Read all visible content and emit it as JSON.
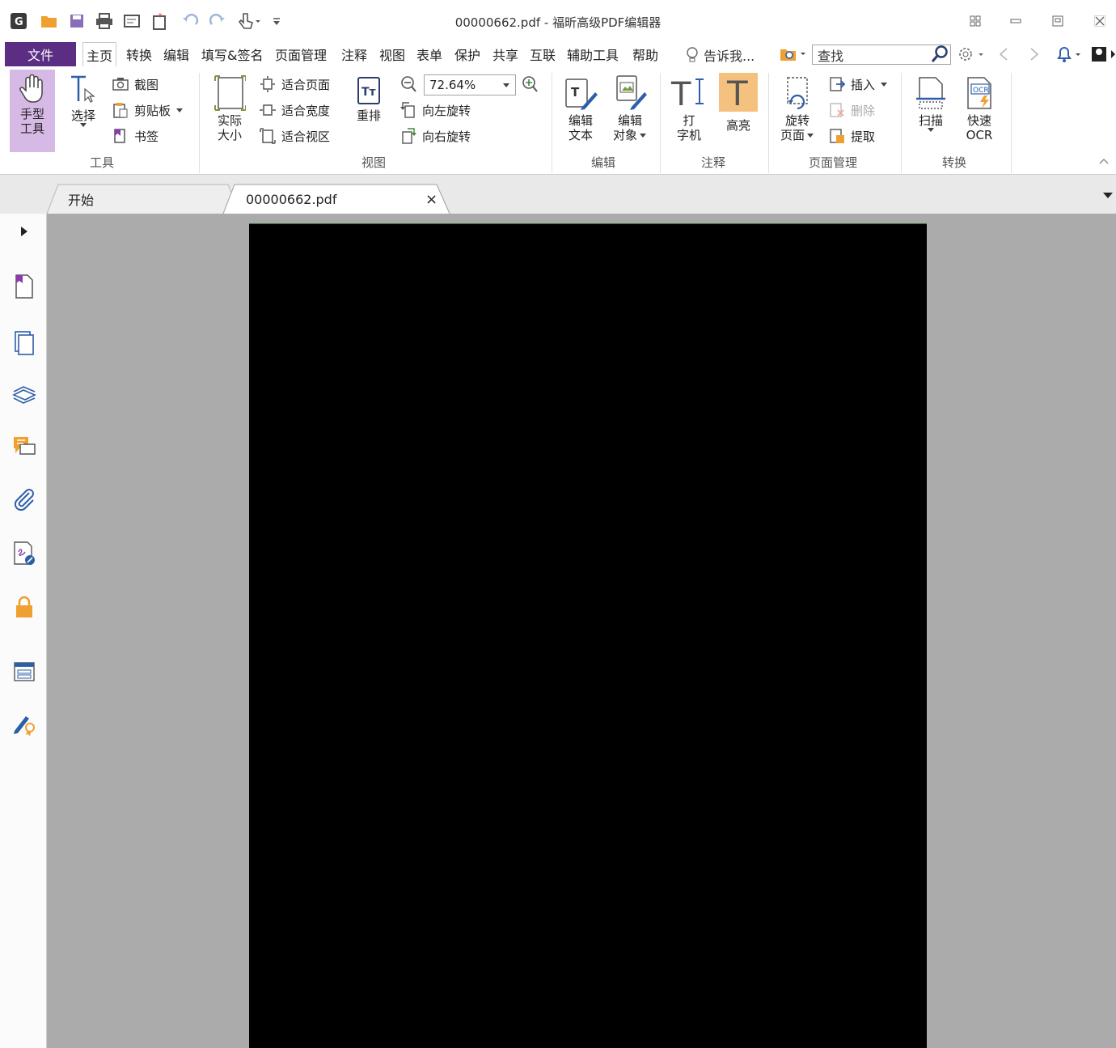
{
  "titlebar": {
    "title": "00000662.pdf - 福昕高级PDF编辑器"
  },
  "menubar": {
    "file": "文件",
    "tabs": [
      "主页",
      "转换",
      "编辑",
      "填写&签名",
      "页面管理",
      "注释",
      "视图",
      "表单",
      "保护",
      "共享",
      "互联",
      "辅助工具",
      "帮助"
    ],
    "tell_me": "告诉我...",
    "search_placeholder": "查找"
  },
  "ribbon": {
    "tools": {
      "group": "工具",
      "hand_l1": "手型",
      "hand_l2": "工具",
      "select": "选择",
      "screenshot": "截图",
      "clipboard": "剪贴板",
      "bookmark": "书签"
    },
    "view": {
      "group": "视图",
      "actual_l1": "实际",
      "actual_l2": "大小",
      "fit_page": "适合页面",
      "fit_width": "适合宽度",
      "fit_visible": "适合视区",
      "reflow": "重排",
      "zoom": "72.64%",
      "rotate_left": "向左旋转",
      "rotate_right": "向右旋转"
    },
    "edit": {
      "group": "编辑",
      "edit_text_l1": "编辑",
      "edit_text_l2": "文本",
      "edit_obj_l1": "编辑",
      "edit_obj_l2": "对象"
    },
    "comment": {
      "group": "注释",
      "typewriter_l1": "打",
      "typewriter_l2": "字机",
      "highlight": "高亮"
    },
    "pages": {
      "group": "页面管理",
      "rotate_l1": "旋转",
      "rotate_l2": "页面",
      "insert": "插入",
      "delete": "删除",
      "extract": "提取"
    },
    "convert": {
      "group": "转换",
      "scan": "扫描",
      "ocr_l1": "快速",
      "ocr_l2": "OCR",
      "ocr_badge": "OCR"
    }
  },
  "doctabs": {
    "start": "开始",
    "file": "00000662.pdf",
    "close": "×"
  },
  "colors": {
    "accent": "#5b2d83",
    "hand_active": "#d7b9e6",
    "highlight_active": "#f4c27e",
    "icon_orange": "#f0a030",
    "icon_blue": "#2d5fa8"
  }
}
